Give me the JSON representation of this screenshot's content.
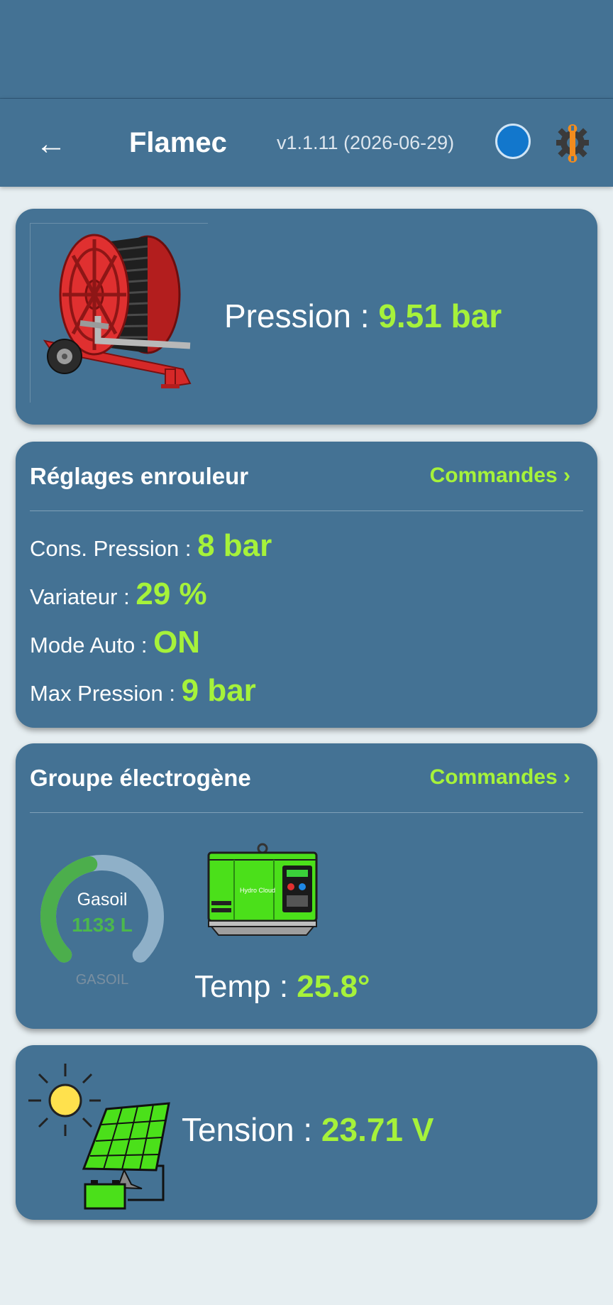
{
  "header": {
    "back_icon": "arrow-left-icon",
    "back_glyph": "←",
    "title": "Flamec",
    "version": "v1.1.11 (2026-06-29)",
    "status_icon": "status-dot-icon",
    "settings_icon": "gear-wrench-icon"
  },
  "colors": {
    "primary": "#447294",
    "accent_green": "#a6f23a",
    "background": "#e6eef1"
  },
  "hose_reel": {
    "image_icon": "hose-reel-icon",
    "pressure_label": "Pression :",
    "pressure_value": "9.51 bar"
  },
  "reel_settings": {
    "title": "Réglages enrouleur",
    "commands_link": "Commandes ›",
    "items": [
      {
        "label": "Cons. Pression :",
        "value": "8 bar"
      },
      {
        "label": "Variateur :",
        "value": "29 %"
      },
      {
        "label": "Mode Auto :",
        "value": "ON"
      },
      {
        "label": "Max Pression :",
        "value": "9 bar"
      }
    ]
  },
  "generator": {
    "title": "Groupe électrogène",
    "commands_link": "Commandes ›",
    "gauge": {
      "label": "Gasoil",
      "value": "1133 L",
      "caption": "GASOIL",
      "fill_fraction": 0.45
    },
    "image_icon": "generator-icon",
    "temp_label": "Temp :",
    "temp_value": "25.8°"
  },
  "solar": {
    "image_icon": "solar-panel-battery-icon",
    "voltage_label": "Tension :",
    "voltage_value": "23.71 V"
  }
}
